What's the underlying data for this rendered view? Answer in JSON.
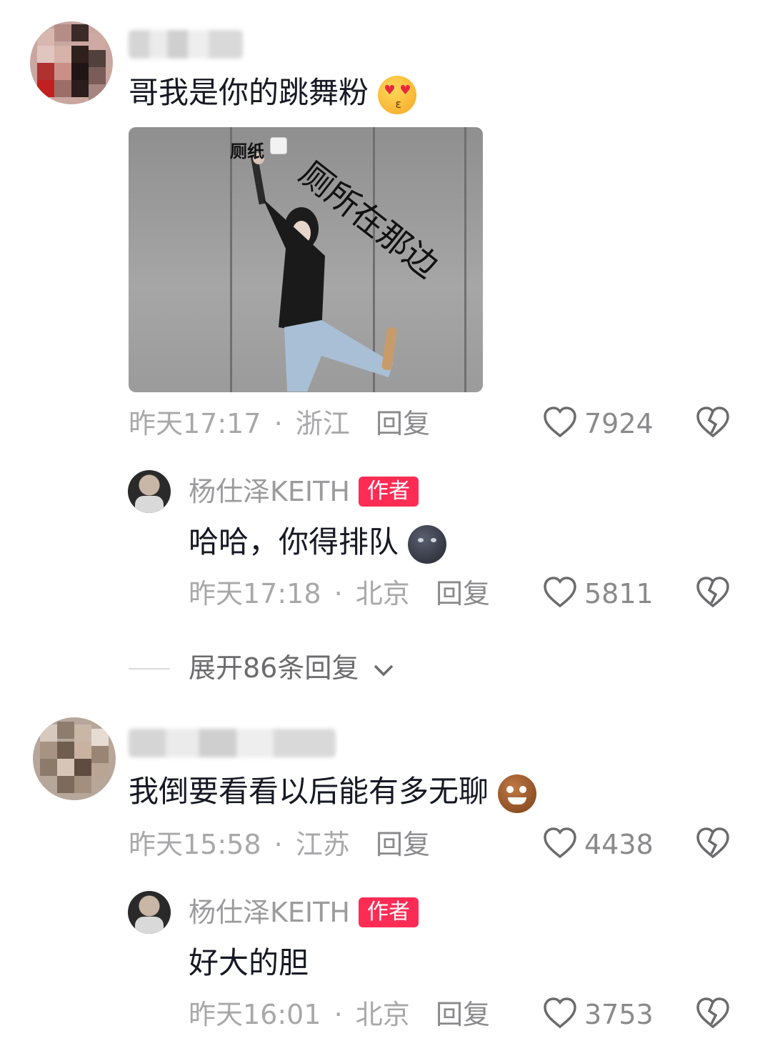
{
  "comments": [
    {
      "text": "哥我是你的跳舞粉",
      "image_caption_1": "厕纸",
      "image_caption_2": "厕所在那边",
      "time": "昨天17:17",
      "location": "浙江",
      "reply_label": "回复",
      "likes": "7924",
      "author_reply": {
        "name": "杨仕泽KEITH",
        "badge": "作者",
        "text": "哈哈，你得排队",
        "time": "昨天17:18",
        "location": "北京",
        "reply_label": "回复",
        "likes": "5811"
      },
      "expand_label": "展开86条回复"
    },
    {
      "text": "我倒要看看以后能有多无聊",
      "time": "昨天15:58",
      "location": "江苏",
      "reply_label": "回复",
      "likes": "4438",
      "author_reply": {
        "name": "杨仕泽KEITH",
        "badge": "作者",
        "text": "好大的胆",
        "time": "昨天16:01",
        "location": "北京",
        "reply_label": "回复",
        "likes": "3753"
      }
    }
  ],
  "separator": "·",
  "colors": {
    "badge": "#fe2c55",
    "meta": "#a8a8aa",
    "text": "#161823"
  }
}
